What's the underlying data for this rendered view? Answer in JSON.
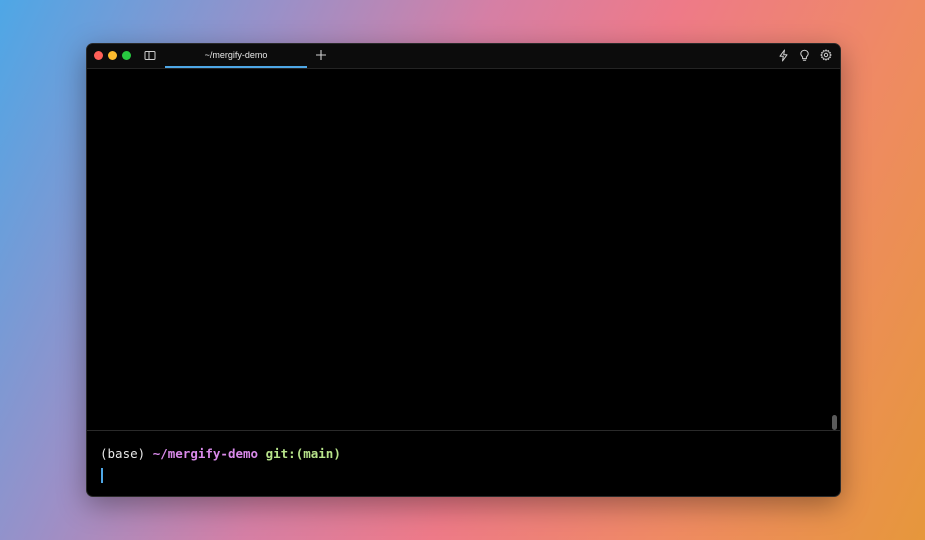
{
  "window": {
    "tab_title": "~/mergify-demo",
    "new_tab_symbol": "+"
  },
  "icons": {
    "panel": "sidebar-panel-icon",
    "bolt": "bolt-icon",
    "bulb": "lightbulb-icon",
    "gear": "gear-icon"
  },
  "prompt": {
    "env": "(base)",
    "dir": "~/mergify-demo",
    "git_prefix": "git:",
    "branch": "(main)"
  },
  "colors": {
    "accent": "#4ea7e6",
    "dir": "#d889e9",
    "git": "#b7e38a",
    "close": "#ff5f57",
    "minimize": "#febc2e",
    "maximize": "#28c840"
  }
}
